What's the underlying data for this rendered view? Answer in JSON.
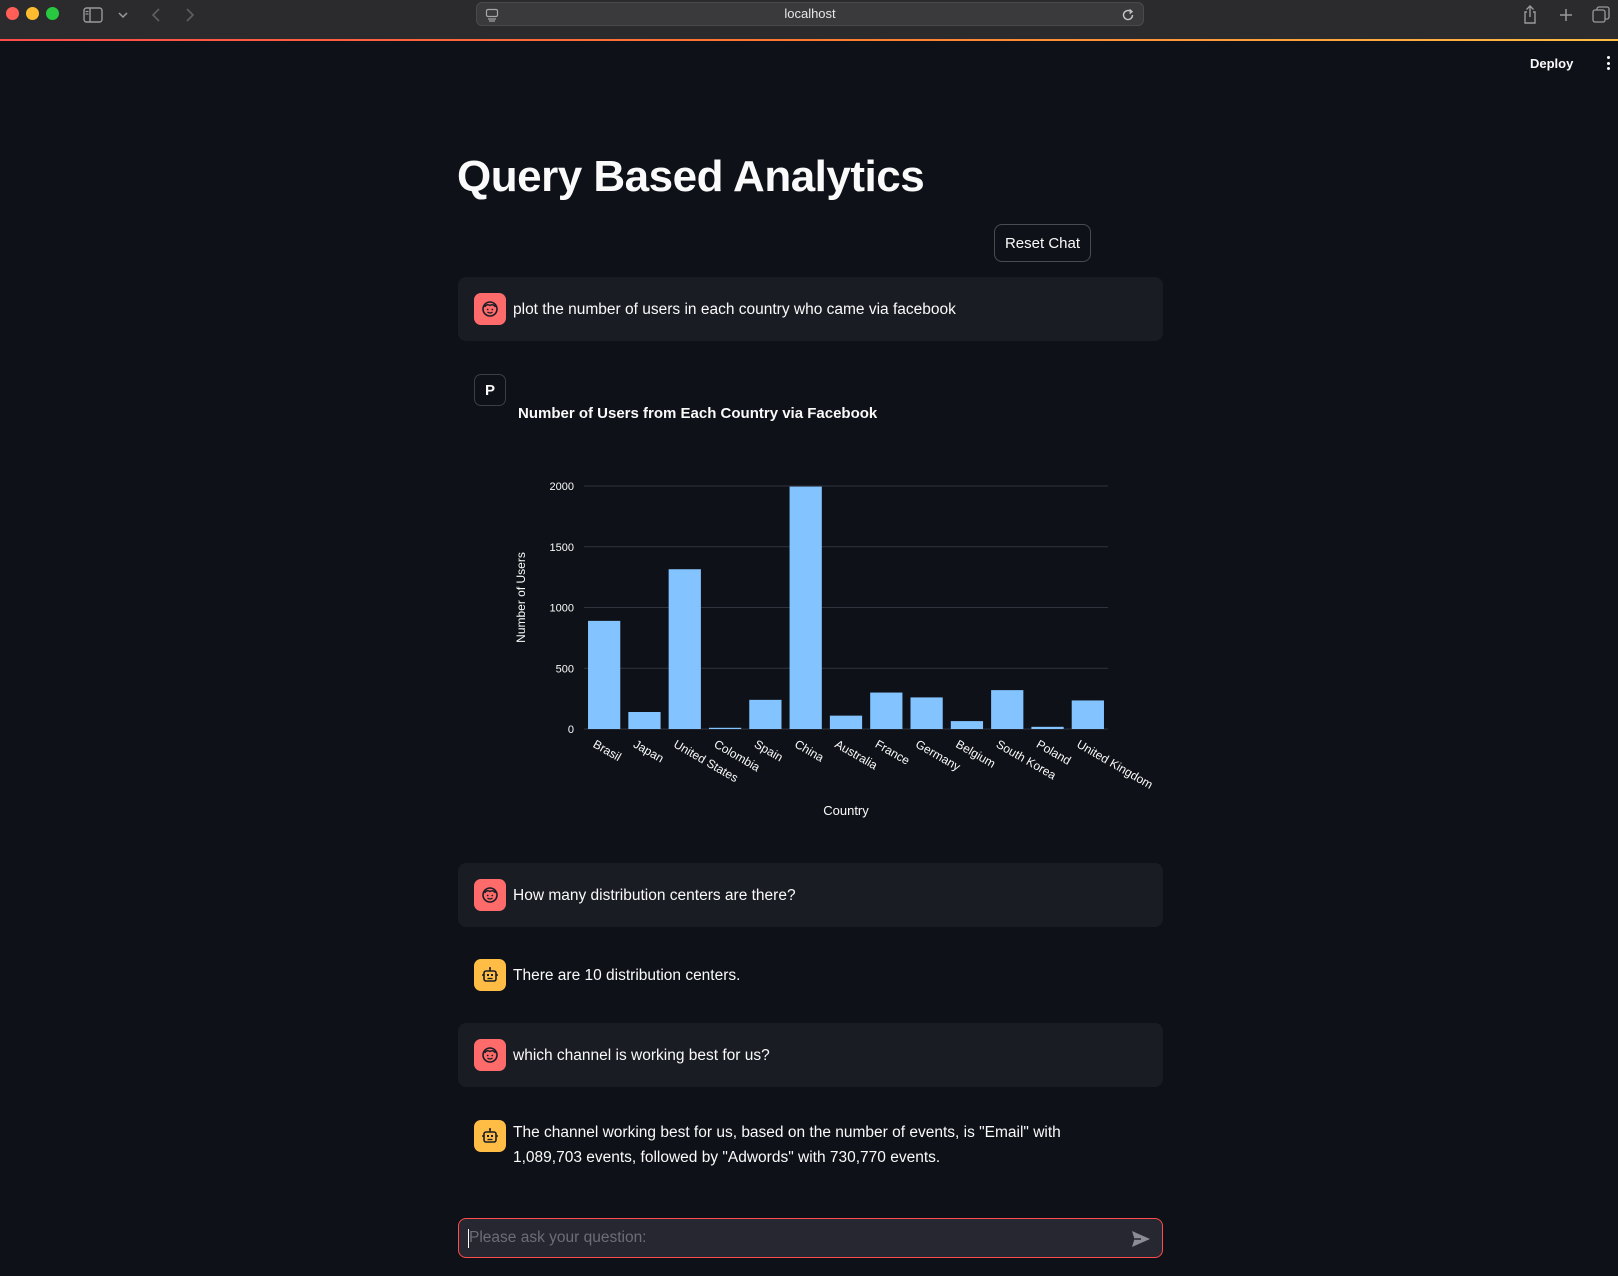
{
  "browser": {
    "url": "localhost"
  },
  "header": {
    "deploy_label": "Deploy"
  },
  "page": {
    "title": "Query Based Analytics",
    "reset_label": "Reset Chat"
  },
  "messages": [
    {
      "role": "user",
      "text": "plot the number of users in each country who came via facebook"
    },
    {
      "role": "assistant",
      "avatar_letter": "P"
    },
    {
      "role": "user",
      "text": "How many distribution centers are there?"
    },
    {
      "role": "assistant",
      "text": "There are 10 distribution centers."
    },
    {
      "role": "user",
      "text": "which channel is working best for us?"
    },
    {
      "role": "assistant",
      "text": "The channel working best for us, based on the number of events, is \"Email\" with 1,089,703 events, followed by \"Adwords\" with 730,770 events."
    }
  ],
  "chat_input": {
    "placeholder": "Please ask your question:"
  },
  "colors": {
    "bar": "#83c3ff",
    "user_avatar": "#ff6b6b",
    "bot_avatar": "#ffbd45",
    "accent": "#ff4b4b"
  },
  "chart_data": {
    "type": "bar",
    "title": "Number of Users from Each Country via Facebook",
    "xlabel": "Country",
    "ylabel": "Number of Users",
    "categories": [
      "Brasil",
      "Japan",
      "United States",
      "Colombia",
      "Spain",
      "China",
      "Australia",
      "France",
      "Germany",
      "Belgium",
      "South Korea",
      "Poland",
      "United Kingdom"
    ],
    "values": [
      890,
      140,
      1315,
      10,
      240,
      1995,
      110,
      300,
      260,
      65,
      320,
      18,
      235
    ],
    "yticks": [
      0,
      500,
      1000,
      1500,
      2000
    ],
    "ylim": [
      0,
      2000
    ],
    "grid": true
  }
}
